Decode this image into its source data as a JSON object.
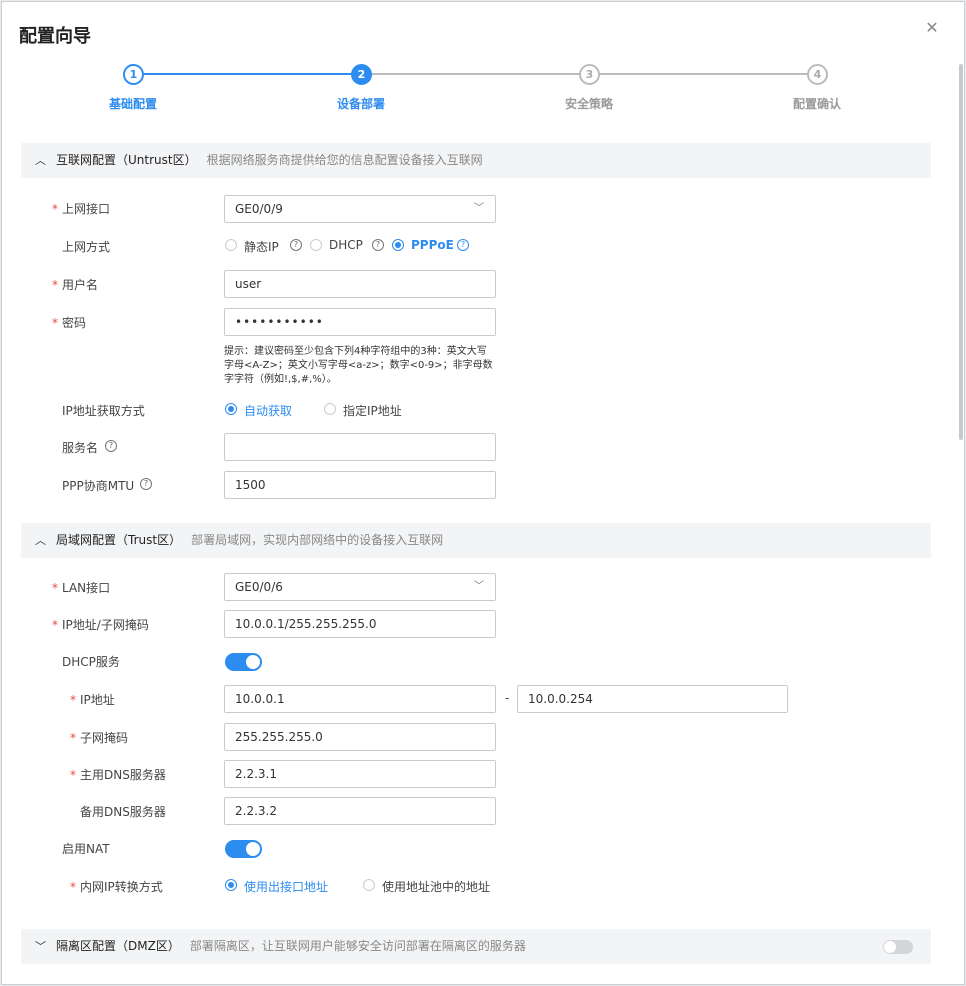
{
  "dialog": {
    "title": "配置向导",
    "close_icon": "close-icon"
  },
  "steps": [
    {
      "num": "1",
      "label": "基础配置",
      "state": "done"
    },
    {
      "num": "2",
      "label": "设备部署",
      "state": "active"
    },
    {
      "num": "3",
      "label": "安全策略",
      "state": "todo"
    },
    {
      "num": "4",
      "label": "配置确认",
      "state": "todo"
    }
  ],
  "internet": {
    "title": "互联网配置（Untrust区）",
    "desc": "根据网络服务商提供给您的信息配置设备接入互联网",
    "iface_label": "上网接口",
    "iface_value": "GE0/0/9",
    "mode_label": "上网方式",
    "modes": [
      "静态IP",
      "DHCP",
      "PPPoE"
    ],
    "mode_selected": "PPPoE",
    "user_label": "用户名",
    "user_value": "user",
    "pwd_label": "密码",
    "pwd_value": "•••••••••••",
    "pwd_hint": "提示：建议密码至少包含下列4种字符组中的3种：英文大写字母<A-Z>；英文小写字母<a-z>；数字<0-9>；非字母数字字符（例如!,$,#,%）。",
    "ip_mode_label": "IP地址获取方式",
    "ip_modes": [
      "自动获取",
      "指定IP地址"
    ],
    "ip_mode_selected": "自动获取",
    "svc_label": "服务名",
    "svc_value": "",
    "mtu_label": "PPP协商MTU",
    "mtu_value": "1500"
  },
  "lan": {
    "title": "局域网配置（Trust区）",
    "desc": "部署局域网，实现内部网络中的设备接入互联网",
    "iface_label": "LAN接口",
    "iface_value": "GE0/0/6",
    "ip_label": "IP地址/子网掩码",
    "ip_value": "10.0.0.1/255.255.255.0",
    "dhcp_label": "DHCP服务",
    "dhcp_on": true,
    "pool_label": "IP地址",
    "pool_start": "10.0.0.1",
    "pool_sep": "-",
    "pool_end": "10.0.0.254",
    "mask_label": "子网掩码",
    "mask_value": "255.255.255.0",
    "dns1_label": "主用DNS服务器",
    "dns1_value": "2.2.3.1",
    "dns2_label": "备用DNS服务器",
    "dns2_value": "2.2.3.2",
    "nat_label": "启用NAT",
    "nat_on": true,
    "nat_mode_label": "内网IP转换方式",
    "nat_modes": [
      "使用出接口地址",
      "使用地址池中的地址"
    ],
    "nat_mode_selected": "使用出接口地址"
  },
  "dmz": {
    "title": "隔离区配置（DMZ区）",
    "desc": "部署隔离区，让互联网用户能够安全访问部署在隔离区的服务器",
    "enabled": false
  },
  "colors": {
    "accent": "#2d8cf0",
    "required": "#e84b3c"
  }
}
